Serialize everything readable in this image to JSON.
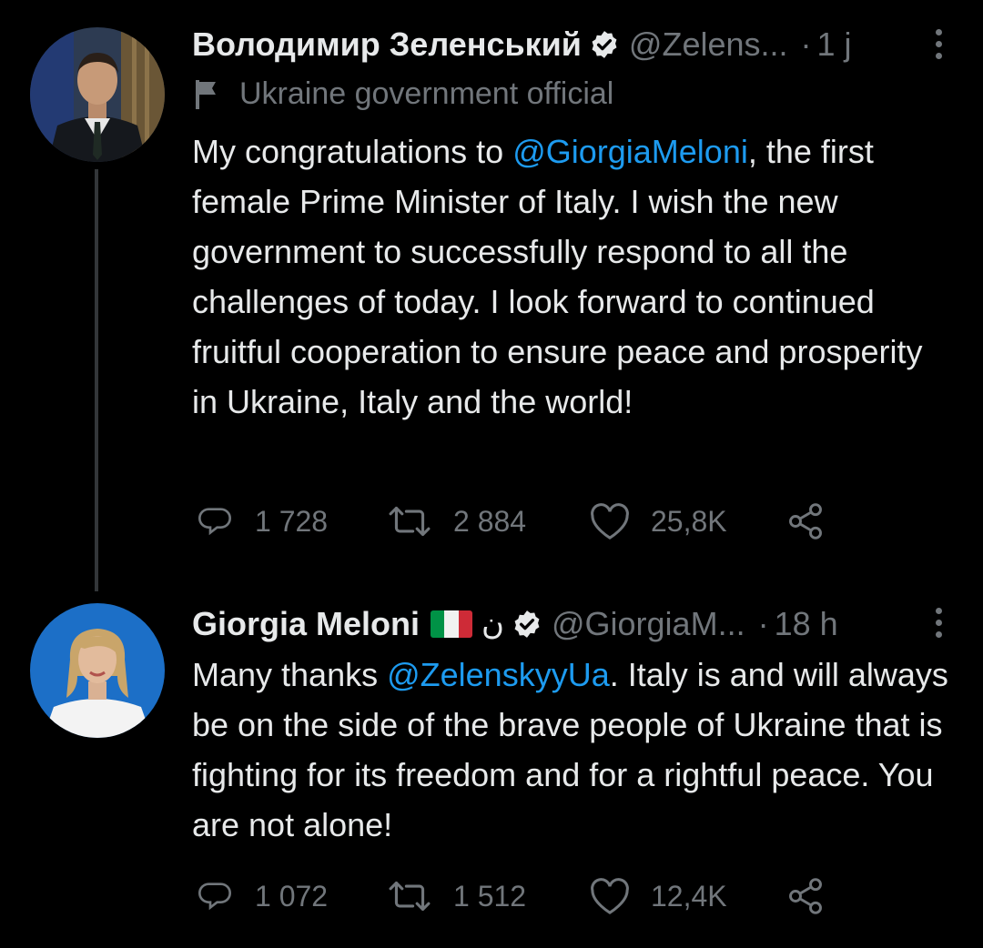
{
  "tweets": [
    {
      "author_name": "Володимир Зеленський",
      "handle": "@Zelens...",
      "time": "1 j",
      "label": "Ukraine government official",
      "text_parts": [
        "My congratulations to ",
        "@GiorgiaMeloni",
        ", the first female Prime Minister of Italy. I wish the new government to successfully respond to all the challenges of today. I look forward to continued fruitful cooperation to ensure peace and prosperity in Ukraine, Italy and the world!"
      ],
      "replies": "1 728",
      "retweets": "2 884",
      "likes": "25,8K",
      "avatar_icon": "avatar-zelensky"
    },
    {
      "author_name": "Giorgia Meloni",
      "name_extra": "ن",
      "handle": "@GiorgiaM...",
      "time": "18 h",
      "text_parts": [
        "Many thanks ",
        "@ZelenskyyUa",
        ". Italy is and will always be on the side of the brave people of Ukraine that is fighting for its freedom and for a rightful peace. You are not alone!"
      ],
      "replies": "1 072",
      "retweets": "1 512",
      "likes": "12,4K",
      "avatar_icon": "avatar-meloni"
    }
  ],
  "colors": {
    "background": "#000000",
    "text": "#e7e9ea",
    "muted": "#71767b",
    "link": "#1d9bf0",
    "thread_line": "#333639"
  }
}
